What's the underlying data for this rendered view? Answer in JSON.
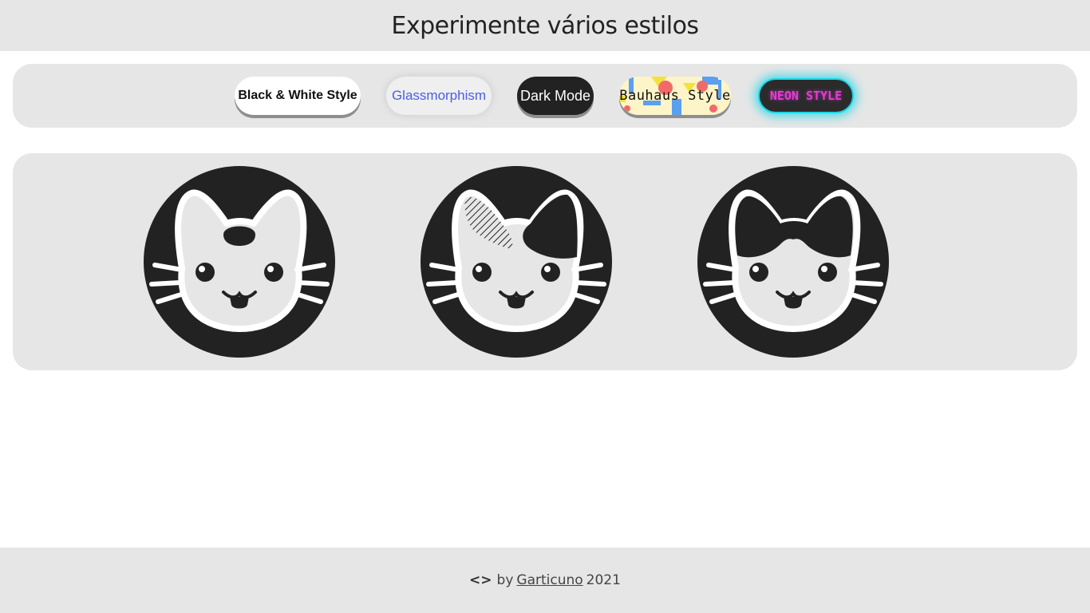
{
  "header": {
    "title": "Experimente vários estilos"
  },
  "styles": {
    "bw_label": "Black & White Style",
    "glass_label": "Glassmorphism",
    "dark_label": "Dark Mode",
    "bauhaus_label": "Bauhaus Style",
    "neon_label": "NEON STYLE"
  },
  "gallery": {
    "items": [
      {
        "name": "cat-face-spot"
      },
      {
        "name": "cat-face-hatched-patch"
      },
      {
        "name": "cat-face-tuxedo"
      }
    ]
  },
  "footer": {
    "icon": "code-icon",
    "by": "by",
    "author": "Garticuno",
    "year": "2021"
  },
  "colors": {
    "panel": "#e6e6e6",
    "dark": "#222222",
    "glass_text": "#4a5ee8",
    "neon_border": "#18d6e6",
    "neon_text": "#e53bd8"
  }
}
